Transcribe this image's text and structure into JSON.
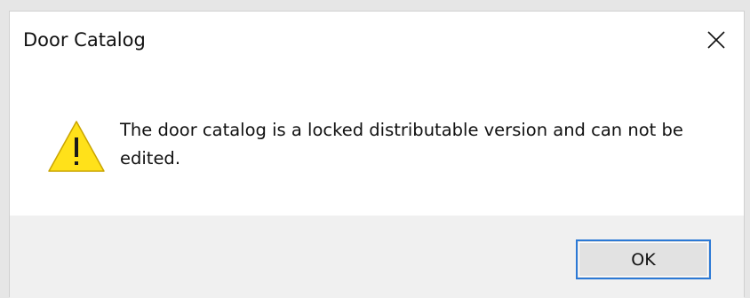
{
  "window": {
    "title": "Door Catalog",
    "close_icon": "close-icon"
  },
  "message": {
    "icon": "warning-icon",
    "text": "The door catalog is a locked distributable version and can not be edited."
  },
  "buttons": {
    "ok_label": "OK"
  },
  "colors": {
    "warning_fill": "#ffe11a",
    "warning_stroke": "#c9a400",
    "button_focus_border": "#2b79d6",
    "footer_bg": "#f0f0f0"
  }
}
